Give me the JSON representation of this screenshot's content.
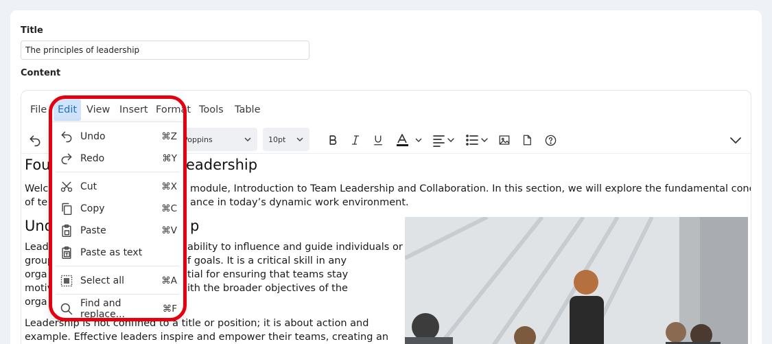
{
  "form": {
    "title_label": "Title",
    "title_value": "The principles of leadership",
    "content_label": "Content"
  },
  "menubar": {
    "items": [
      "File",
      "Edit",
      "View",
      "Insert",
      "Format",
      "Tools",
      "Table"
    ],
    "active": "Edit"
  },
  "toolbar": {
    "font_family": "Poppins",
    "font_size": "10pt",
    "icons": [
      "undo-icon",
      "bold-icon",
      "italic-icon",
      "underline-icon",
      "text-color-icon",
      "align-icon",
      "list-icon",
      "image-icon",
      "document-icon",
      "help-icon",
      "more-icon"
    ],
    "text_color": "#1a1a1a"
  },
  "edit_menu": {
    "items": [
      {
        "label": "Undo",
        "shortcut": "⌘Z",
        "icon": "undo-icon"
      },
      {
        "label": "Redo",
        "shortcut": "⌘Y",
        "icon": "redo-icon"
      },
      {
        "label": "Cut",
        "shortcut": "⌘X",
        "icon": "cut-icon"
      },
      {
        "label": "Copy",
        "shortcut": "⌘C",
        "icon": "copy-icon"
      },
      {
        "label": "Paste",
        "shortcut": "⌘V",
        "icon": "paste-icon"
      },
      {
        "label": "Paste as text",
        "shortcut": "",
        "icon": "paste-text-icon"
      },
      {
        "label": "Select all",
        "shortcut": "⌘A",
        "icon": "select-all-icon"
      },
      {
        "label": "Find and replace...",
        "shortcut": "⌘F",
        "icon": "search-icon"
      }
    ],
    "highlight_color": "#e4000f"
  },
  "document": {
    "heading1_left": "Fou",
    "heading1_right": "eadership",
    "intro_line1_left": "Welc",
    "intro_line1_right": "module, Introduction to Team Leadership and Collaboration. In this section, we will explore the fundamental concepts",
    "intro_line2_left": "of te",
    "intro_line2_right": "ance in today’s dynamic work environment.",
    "heading2_left": "Und",
    "heading2_right": "p",
    "para1_right_lines": [
      "ability to influence and guide individuals or",
      "f goals. It is a critical skill in any",
      "tial for ensuring that teams stay",
      "ith the broader objectives of the"
    ],
    "para1_left_lines": [
      "Lead",
      "group",
      "orga",
      "motiv",
      "orga"
    ],
    "para2_lines": [
      "Leadership is not confined to a title or position; it is about action and",
      "example. Effective leaders inspire and empower their teams, creating an"
    ]
  }
}
